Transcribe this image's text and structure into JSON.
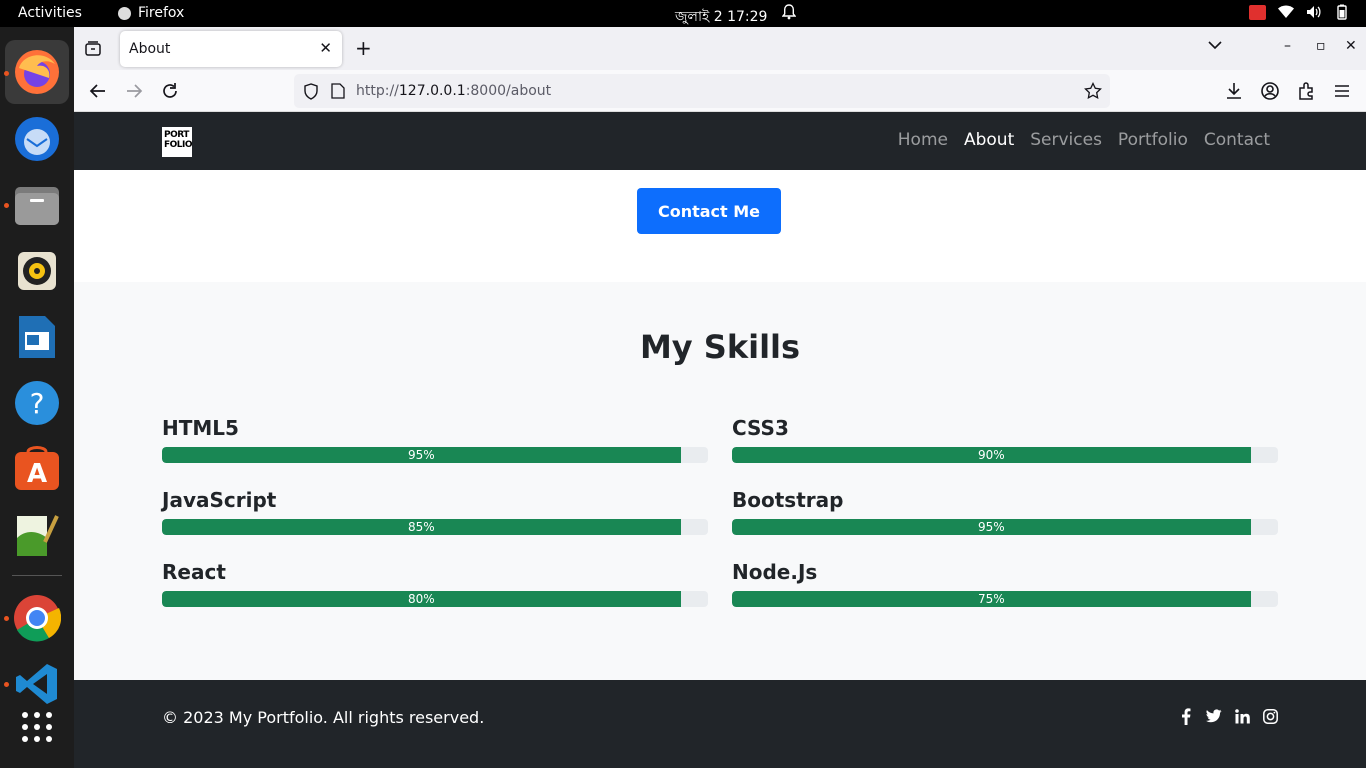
{
  "system": {
    "activities": "Activities",
    "app_name": "Firefox",
    "clock": "জুলাই 2  17:29"
  },
  "browser": {
    "tab_title": "About",
    "url_prefix": "http://",
    "url_host": "127.0.0.1",
    "url_rest": ":8000/about"
  },
  "site": {
    "logo_lines": [
      "PORT",
      "FOLIO"
    ],
    "nav": [
      "Home",
      "About",
      "Services",
      "Portfolio",
      "Contact"
    ],
    "active_nav": "About",
    "contact_button": "Contact Me",
    "skills_title": "My Skills",
    "skills": [
      {
        "name": "HTML5",
        "level": "95%"
      },
      {
        "name": "CSS3",
        "level": "90%"
      },
      {
        "name": "JavaScript",
        "level": "85%"
      },
      {
        "name": "Bootstrap",
        "level": "95%"
      },
      {
        "name": "React",
        "level": "80%"
      },
      {
        "name": "Node.Js",
        "level": "75%"
      }
    ],
    "copyright": "© 2023 My Portfolio. All rights reserved.",
    "socials": [
      "facebook-icon",
      "twitter-icon",
      "linkedin-icon",
      "instagram-icon"
    ]
  },
  "colors": {
    "accent": "#0d6efd",
    "progress": "#198754",
    "dark": "#212529"
  }
}
